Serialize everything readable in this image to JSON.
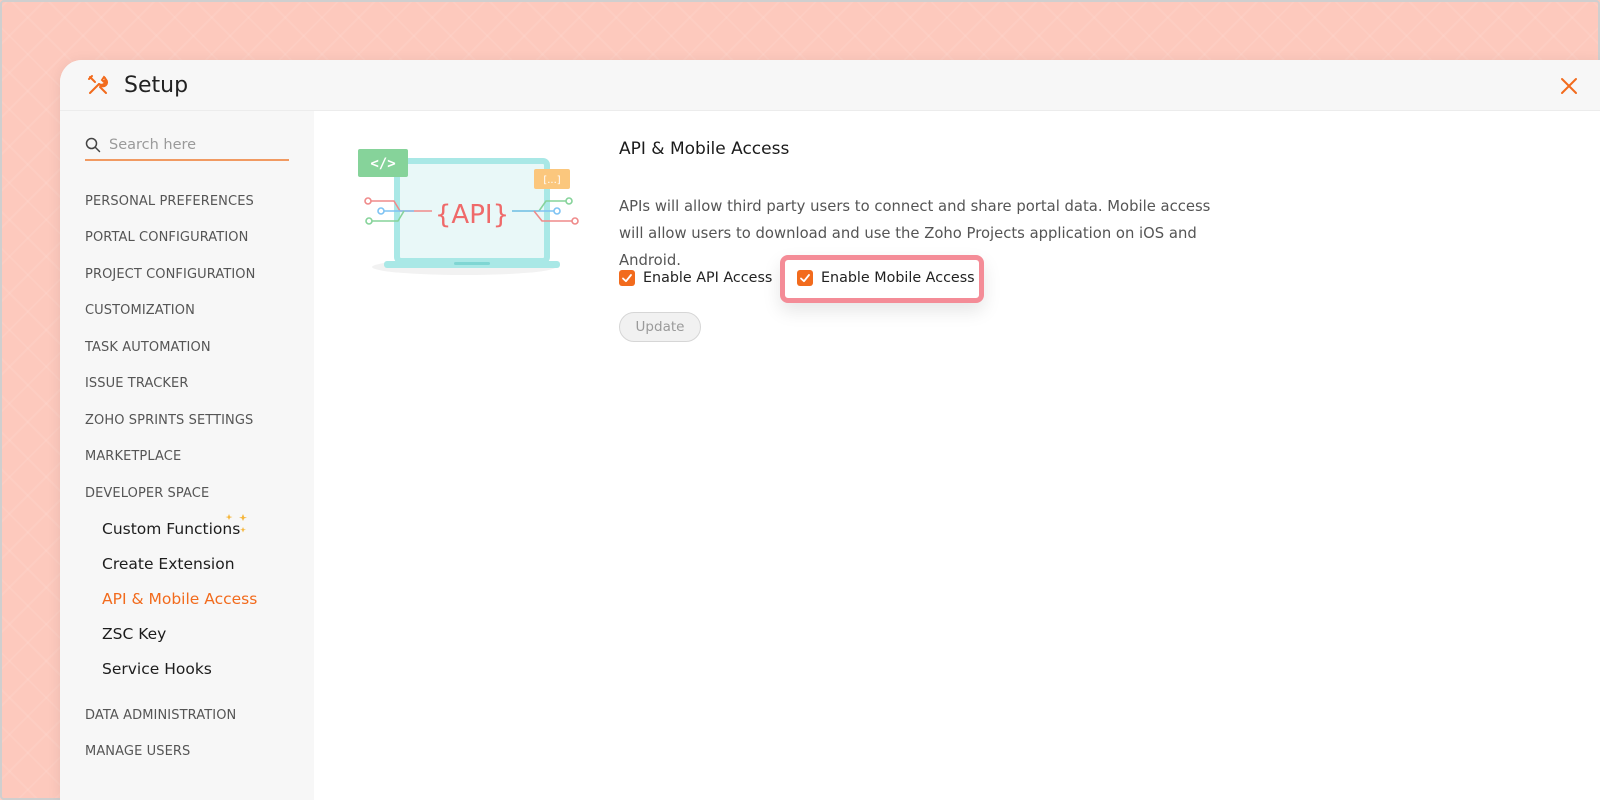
{
  "header": {
    "title": "Setup",
    "logo_icon": "tools-icon",
    "close_icon": "close-icon",
    "accent": "#f26b1d"
  },
  "sidebar": {
    "search": {
      "placeholder": "Search here",
      "value": ""
    },
    "sections": [
      "PERSONAL PREFERENCES",
      "PORTAL CONFIGURATION",
      "PROJECT CONFIGURATION",
      "CUSTOMIZATION",
      "TASK AUTOMATION",
      "ISSUE TRACKER",
      "ZOHO SPRINTS SETTINGS",
      "MARKETPLACE",
      "DEVELOPER SPACE"
    ],
    "developer_items": [
      "Custom Functions",
      "Create Extension",
      "API & Mobile Access",
      "ZSC Key",
      "Service Hooks"
    ],
    "active_item": "API & Mobile Access",
    "bottom_sections": [
      "DATA ADMINISTRATION",
      "MANAGE USERS"
    ]
  },
  "main": {
    "title": "API & Mobile Access",
    "description": "APIs will allow third party users to connect and share portal data. Mobile access will allow users to download and use the Zoho Projects application on iOS and Android.",
    "illustration": {
      "api_label": "{API}",
      "code_badge": "</>",
      "bracket_badge": "[...]"
    },
    "checkboxes": [
      {
        "label": "Enable API Access",
        "checked": true
      },
      {
        "label": "Enable Mobile Access",
        "checked": true
      }
    ],
    "update_label": "Update"
  }
}
